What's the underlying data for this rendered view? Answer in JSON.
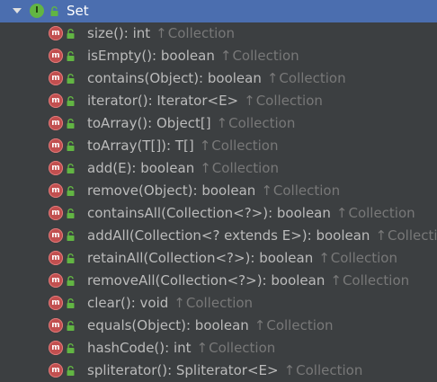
{
  "header": {
    "icon": "interface-icon",
    "badge_letter": "I",
    "title": "Set"
  },
  "method_badge_letter": "m",
  "inherited_arrow": "↑",
  "colors": {
    "selection": "#4b6eaf",
    "background": "#3c3f41",
    "text": "#bbbbbb",
    "muted": "#787878",
    "method_badge": "#c24f4f",
    "interface_badge": "#62b543",
    "lock": "#62b543"
  },
  "members": [
    {
      "signature": "size(): int",
      "origin": "Collection"
    },
    {
      "signature": "isEmpty(): boolean",
      "origin": "Collection"
    },
    {
      "signature": "contains(Object): boolean",
      "origin": "Collection"
    },
    {
      "signature": "iterator(): Iterator<E>",
      "origin": "Collection"
    },
    {
      "signature": "toArray(): Object[]",
      "origin": "Collection"
    },
    {
      "signature": "toArray(T[]): T[]",
      "origin": "Collection"
    },
    {
      "signature": "add(E): boolean",
      "origin": "Collection"
    },
    {
      "signature": "remove(Object): boolean",
      "origin": "Collection"
    },
    {
      "signature": "containsAll(Collection<?>): boolean",
      "origin": "Collection"
    },
    {
      "signature": "addAll(Collection<? extends E>): boolean",
      "origin": "Collection"
    },
    {
      "signature": "retainAll(Collection<?>): boolean",
      "origin": "Collection"
    },
    {
      "signature": "removeAll(Collection<?>): boolean",
      "origin": "Collection"
    },
    {
      "signature": "clear(): void",
      "origin": "Collection"
    },
    {
      "signature": "equals(Object): boolean",
      "origin": "Collection"
    },
    {
      "signature": "hashCode(): int",
      "origin": "Collection"
    },
    {
      "signature": "spliterator(): Spliterator<E>",
      "origin": "Collection"
    }
  ]
}
